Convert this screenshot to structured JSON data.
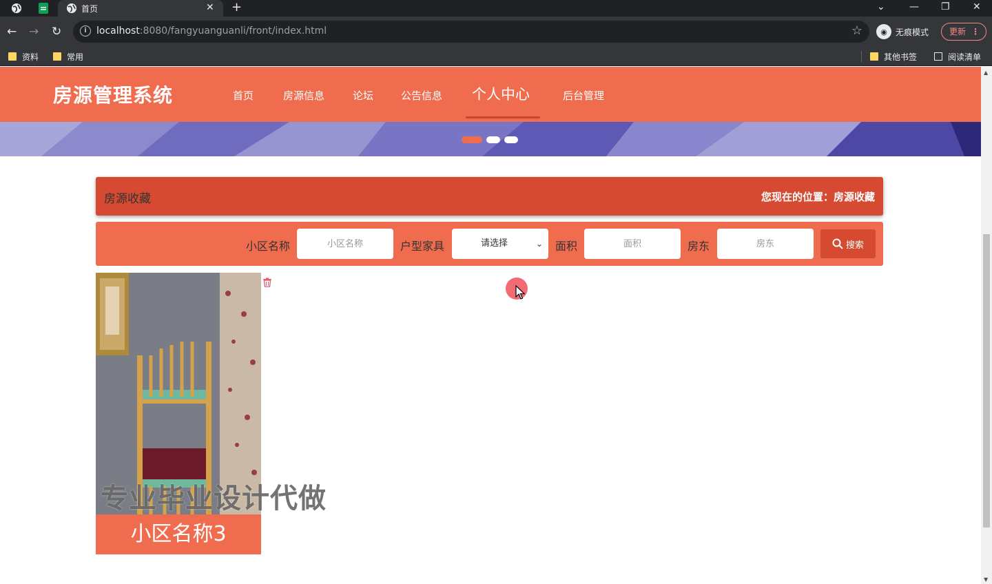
{
  "browser": {
    "tab_title": "首页",
    "url_host": "localhost",
    "url_path": ":8080/fangyuanguanli/front/index.html",
    "incognito_label": "无痕模式",
    "update_label": "更新",
    "bookmarks": [
      "资料",
      "常用"
    ],
    "bookmarks_right": [
      "其他书签",
      "阅读清单"
    ]
  },
  "site": {
    "title": "房源管理系统",
    "nav": [
      "首页",
      "房源信息",
      "论坛",
      "公告信息",
      "个人中心",
      "后台管理"
    ],
    "active_nav": "个人中心"
  },
  "breadcrumb": {
    "title": "房源收藏",
    "location": "您现在的位置：房源收藏"
  },
  "search": {
    "label_community": "小区名称",
    "placeholder_community": "小区名称",
    "label_layout": "户型家具",
    "select_value": "请选择",
    "label_area": "面积",
    "placeholder_area": "面积",
    "label_landlord": "房东",
    "placeholder_landlord": "房东",
    "button_label": "搜索"
  },
  "cards": [
    {
      "name": "小区名称3"
    }
  ],
  "watermark": "专业毕业设计代做",
  "colors": {
    "primary": "#ef6c4e",
    "dark": "#d54a30"
  }
}
